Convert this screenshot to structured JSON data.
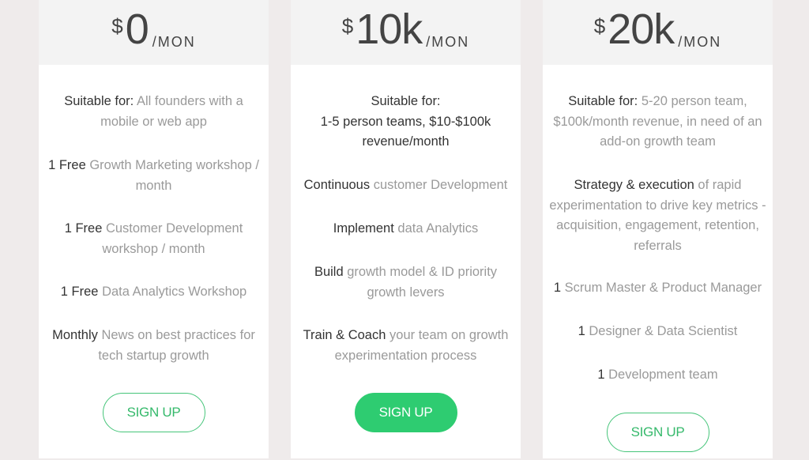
{
  "colors": {
    "accent": "#2ecc71",
    "background": "#efebeb",
    "header_band": "#f3f3f3",
    "strong_text": "#333333",
    "muted_text": "#9a9a9a"
  },
  "plans": [
    {
      "price": {
        "currency": "$",
        "amount": "0",
        "period": "/MON"
      },
      "features": [
        {
          "strong": "Suitable for:",
          "muted": "All founders with a mobile or web app"
        },
        {
          "strong": "1 Free",
          "muted": "Growth Marketing workshop / month"
        },
        {
          "strong": "1 Free",
          "muted": "Customer Development workshop / month"
        },
        {
          "strong": "1 Free",
          "muted": "Data Analytics Workshop"
        },
        {
          "strong": "Monthly",
          "muted": "News on best practices for tech startup growth"
        }
      ],
      "cta": {
        "label": "SIGN UP",
        "style": "outline"
      }
    },
    {
      "price": {
        "currency": "$",
        "amount": "10k",
        "period": "/MON"
      },
      "features": [
        {
          "strong": "Suitable for:",
          "strong_line2": "1-5 person teams, $10-$100k revenue/month",
          "muted": ""
        },
        {
          "strong": "Continuous",
          "muted": "customer Development"
        },
        {
          "strong": "Implement",
          "muted": "data Analytics"
        },
        {
          "strong": "Build",
          "muted": "growth model & ID priority growth levers"
        },
        {
          "strong": "Train & Coach",
          "muted": "your team on growth experimentation process"
        }
      ],
      "cta": {
        "label": "SIGN UP",
        "style": "filled"
      }
    },
    {
      "price": {
        "currency": "$",
        "amount": "20k",
        "period": "/MON"
      },
      "features": [
        {
          "strong": "Suitable for:",
          "muted": "5-20 person team, $100k/month revenue, in need of an add-on growth team"
        },
        {
          "strong": "Strategy & execution",
          "muted": "of rapid experimentation to drive key metrics - acquisition, engagement, retention, referrals"
        },
        {
          "strong": "1",
          "muted": "Scrum Master & Product Manager"
        },
        {
          "strong": "1",
          "muted": "Designer & Data Scientist"
        },
        {
          "strong": "1",
          "muted": "Development team"
        }
      ],
      "cta": {
        "label": "SIGN UP",
        "style": "outline"
      }
    }
  ]
}
